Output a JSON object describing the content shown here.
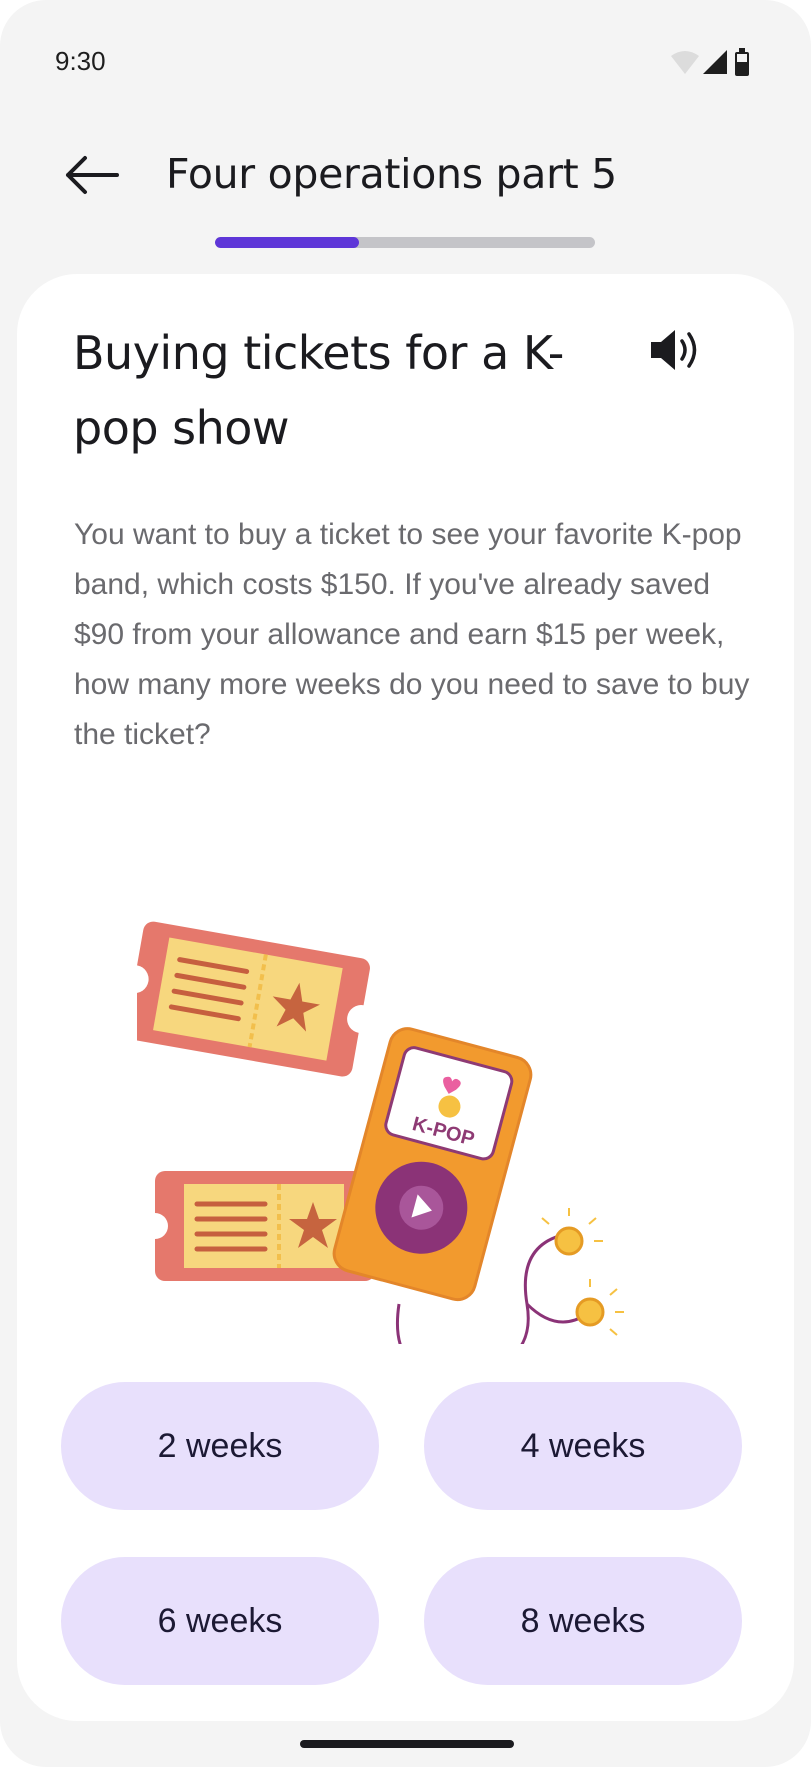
{
  "status_bar": {
    "time": "9:30",
    "icons": [
      "wifi-icon",
      "signal-icon",
      "battery-icon"
    ]
  },
  "header": {
    "back_icon": "arrow-left-icon",
    "title": "Four operations part 5",
    "progress": 0.38
  },
  "card": {
    "headline": "Buying tickets for a K-pop show",
    "speaker_icon": "speaker-icon",
    "question": "You want to buy a ticket to see your favorite K-pop band, which costs $150. If you've already saved $90 from your allowance and earn $15 per week, how many more weeks do you need to save to buy the ticket?",
    "illustration": {
      "screen_text": "K-POP"
    }
  },
  "answers": [
    {
      "label": "2 weeks"
    },
    {
      "label": "4 weeks"
    },
    {
      "label": "6 weeks"
    },
    {
      "label": "8 weeks"
    }
  ],
  "colors": {
    "background": "#f4f4f4",
    "card": "#ffffff",
    "progress_fill": "#5e36d8",
    "progress_track": "#c4c4c8",
    "answer_bg": "#e8e0fc",
    "question_text": "#6a6a6e"
  }
}
